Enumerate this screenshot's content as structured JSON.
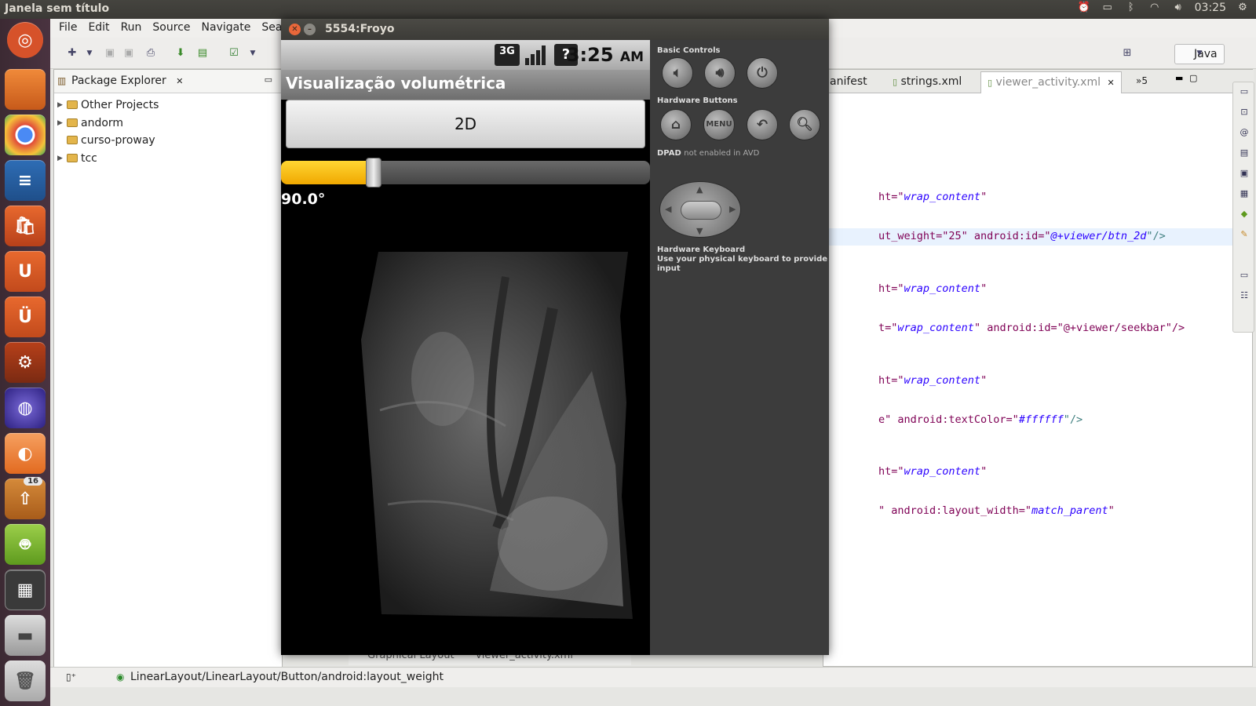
{
  "top_panel": {
    "window_title": "Janela sem título",
    "clock": "03:25"
  },
  "launcher": {
    "badge_count": "16"
  },
  "eclipse": {
    "menu": [
      "File",
      "Edit",
      "Run",
      "Source",
      "Navigate",
      "Search"
    ],
    "perspective": "Java",
    "package_explorer": {
      "title": "Package Explorer",
      "items": [
        {
          "label": "Other Projects",
          "expandable": true
        },
        {
          "label": "andorm",
          "expandable": true
        },
        {
          "label": "curso-proway",
          "expandable": false
        },
        {
          "label": "tcc",
          "expandable": true
        }
      ]
    },
    "editor_tabs": [
      "anifest",
      "strings.xml",
      "viewer_activity.xml",
      "»5"
    ],
    "code_lines": [
      {
        "pre": "ht=\"",
        "val": "wrap_content",
        "post": "\""
      },
      {
        "pre": "ut_weight=\"25\" android:id=\"",
        "val": "@+viewer/btn_2d",
        "post": "\"/>"
      },
      {
        "pre": "ht=\"",
        "val": "wrap_content",
        "post": "\""
      },
      {
        "pre": "t=\"",
        "val": "wrap_content",
        "post": "\" android:id=\"@+viewer/seekbar\"/>"
      },
      {
        "pre": "ht=\"",
        "val": "wrap_content",
        "post": "\""
      },
      {
        "pre": "e\" android:textColor=\"",
        "val": "#ffffff",
        "post": "\"/>"
      },
      {
        "pre": "ht=\"",
        "val": "wrap_content",
        "post": "\""
      },
      {
        "pre": "\" android:layout_width=\"",
        "val": "match_parent",
        "post": "\""
      }
    ],
    "bottom_tabs": [
      "Graphical Layout",
      "viewer_activity.xml"
    ],
    "status_text": "LinearLayout/LinearLayout/Button/android:layout_weight"
  },
  "emulator": {
    "window_title": "5554:Froyo",
    "status_bar": {
      "network": "3G",
      "time": "3:25",
      "ampm": "AM"
    },
    "app_title": "Visualização volumétrica",
    "button_2d": "2D",
    "seekbar_fraction": 0.25,
    "angle_text": "90.0°",
    "controls": {
      "basic_controls": "Basic Controls",
      "hardware_buttons": "Hardware Buttons",
      "menu_label": "MENU",
      "dpad_label": "DPAD",
      "dpad_note": "not enabled in AVD",
      "keyboard_title": "Hardware Keyboard",
      "keyboard_note": "Use your physical keyboard to provide input"
    }
  },
  "colors": {
    "seekbar_accent": "#f5b800",
    "launcher_bg": "#3c2a33",
    "code_attr": "#7f0055",
    "code_value": "#2a00ff"
  }
}
